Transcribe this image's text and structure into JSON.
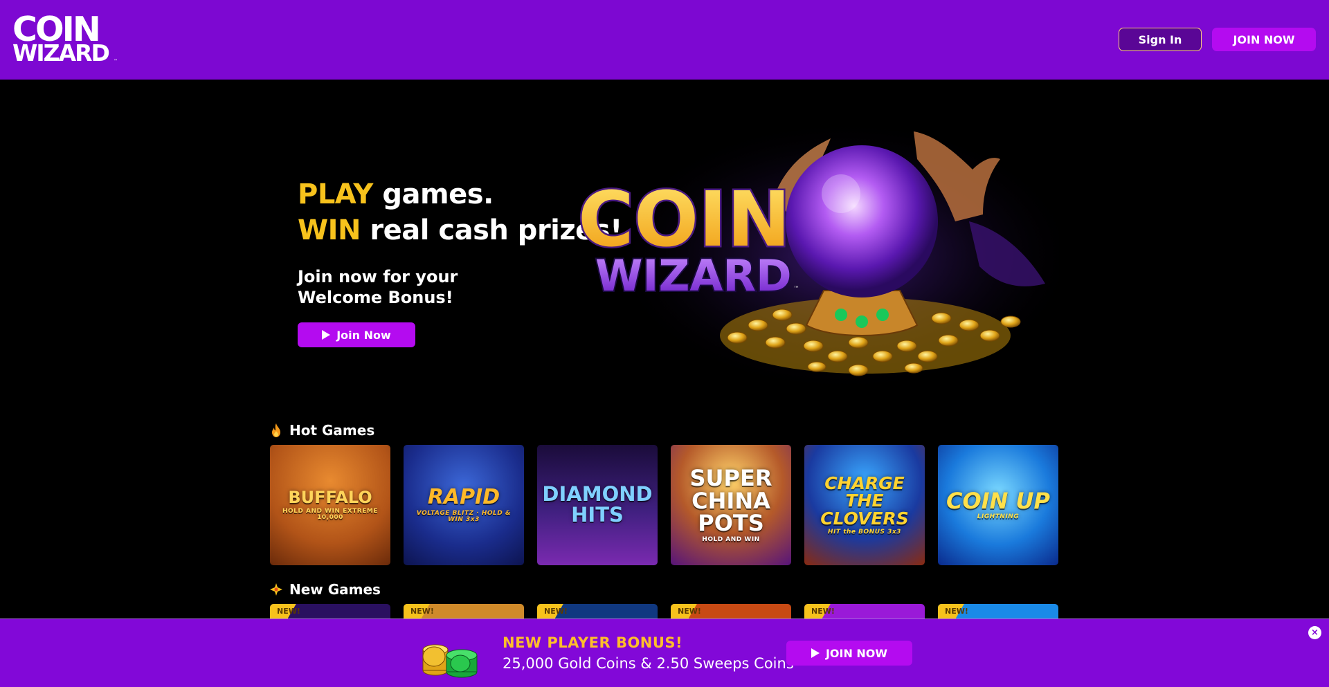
{
  "header": {
    "logo_line1": "COIN",
    "logo_line2": "WIZARD",
    "logo_tm": "™",
    "signin_label": "Sign In",
    "join_label": "JOIN NOW"
  },
  "hero": {
    "line1_highlight": "PLAY",
    "line1_rest": " games.",
    "line2_highlight": "WIN",
    "line2_rest": " real cash prizes!",
    "sub_line1": "Join now for your",
    "sub_line2": "Welcome Bonus!",
    "cta_label": "Join Now",
    "art_logo_line1": "COIN",
    "art_logo_line2": "WIZARD",
    "art_tm": "™"
  },
  "hot_games": {
    "title": "Hot Games",
    "icon": "fire-icon",
    "items": [
      {
        "name": "BUFFALO",
        "sub": "HOLD AND WIN EXTREME 10,000"
      },
      {
        "name": "RAPID",
        "sub": "VOLTAGE BLITZ · HOLD & WIN 3x3"
      },
      {
        "name": "DIAMOND HITS",
        "sub": ""
      },
      {
        "name": "SUPER CHINA POTS",
        "sub": "HOLD AND WIN"
      },
      {
        "name": "CHARGE THE CLOVERS",
        "sub": "HIT the BONUS 3x3"
      },
      {
        "name": "COIN UP",
        "sub": "LIGHTNING"
      }
    ]
  },
  "new_games": {
    "title": "New Games",
    "icon": "sparkle-icon",
    "badge": "NEW!"
  },
  "banner": {
    "title": "NEW PLAYER BONUS!",
    "subtitle": "25,000 Gold Coins & 2.50 Sweeps Coins",
    "cta_label": "JOIN NOW",
    "close_symbol": "×"
  },
  "colors": {
    "header_bg": "#7d08d2",
    "accent_gold": "#f7c21c",
    "button_purple": "#b40bf0",
    "banner_bg": "#8208d8"
  }
}
